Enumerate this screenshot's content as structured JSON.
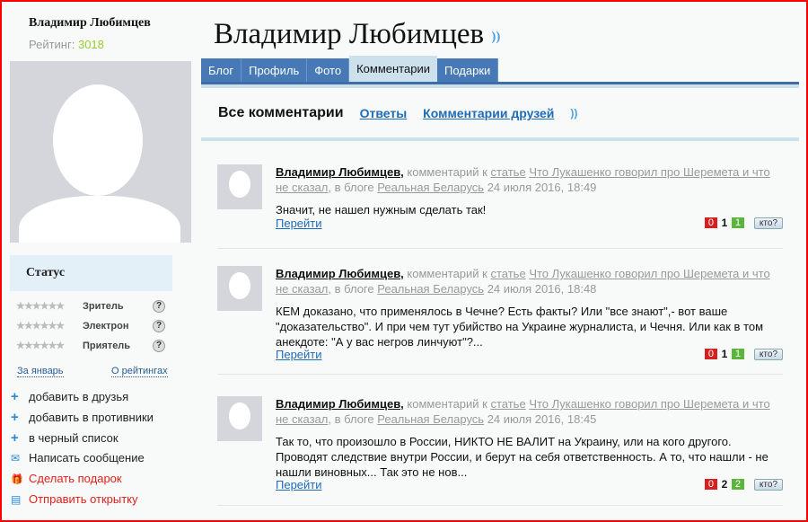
{
  "sidebar": {
    "name": "Владимир Любимцев",
    "rating_label": "Рейтинг:",
    "rating_value": "3018",
    "status_title": "Статус",
    "statuses": [
      {
        "stars": "★★★★★★",
        "label": "Зритель",
        "help": "?"
      },
      {
        "stars": "★★★★★★",
        "label": "Электрон",
        "help": "?"
      },
      {
        "stars": "★★★★★★",
        "label": "Приятель",
        "help": "?"
      }
    ],
    "link_month": "За январь",
    "link_about": "О рейтингах",
    "actions": [
      {
        "icon": "+",
        "label": "добавить в друзья"
      },
      {
        "icon": "+",
        "label": "добавить в противники"
      },
      {
        "icon": "+",
        "label": "в черный список"
      },
      {
        "icon": "✉",
        "label": "Написать сообщение"
      },
      {
        "icon": "🎁",
        "label": "Сделать подарок"
      },
      {
        "icon": "▤",
        "label": "Отправить открытку"
      }
    ]
  },
  "header": {
    "title": "Владимир Любимцев",
    "rss": "))"
  },
  "tabs": [
    "Блог",
    "Профиль",
    "Фото",
    "Комментарии",
    "Подарки"
  ],
  "subnav": {
    "current": "Все комментарии",
    "answers": "Ответы",
    "friends": "Комментарии друзей"
  },
  "comments": [
    {
      "author": "Владимир Любимцев,",
      "meta1": " комментарий к ",
      "article_word": "статье",
      "article": "Что Лукашенко говорил про Шеремета и что не сказал",
      "meta2": ", в блоге ",
      "blog": "Реальная Беларусь",
      "date": " 24 июля 2016, 18:49",
      "text": "Значит, не нашел нужным сделать так!",
      "go": "Перейти",
      "minus": "0",
      "total": "1",
      "plus": "1",
      "who": "кто?"
    },
    {
      "author": "Владимир Любимцев,",
      "meta1": " комментарий к ",
      "article_word": "статье",
      "article": "Что Лукашенко говорил про Шеремета и что не сказал",
      "meta2": ", в блоге ",
      "blog": "Реальная Беларусь",
      "date": " 24 июля 2016, 18:48",
      "text": "КЕМ доказано, что применялось в Чечне? Есть факты? Или \"все знают\",- вот ваше \"доказательство\". И при чем тут убийство на Украине журналиста, и Чечня. Или как в том анекдоте: \"А у вас негров линчуют\"?...",
      "go": "Перейти",
      "minus": "0",
      "total": "1",
      "plus": "1",
      "who": "кто?"
    },
    {
      "author": "Владимир Любимцев,",
      "meta1": " комментарий к ",
      "article_word": "статье",
      "article": "Что Лукашенко говорил про Шеремета и что не сказал",
      "meta2": ", в блоге ",
      "blog": "Реальная Беларусь",
      "date": " 24 июля 2016, 18:45",
      "text": "Так то, что произошло в России, НИКТО НЕ ВАЛИТ на Украину, или на кого другого. Проводят следствие внутри России, и берут на себя ответственность. А то, что нашли - не нашли виновных... Так это не нов...",
      "go": "Перейти",
      "minus": "0",
      "total": "2",
      "plus": "2",
      "who": "кто?"
    }
  ]
}
